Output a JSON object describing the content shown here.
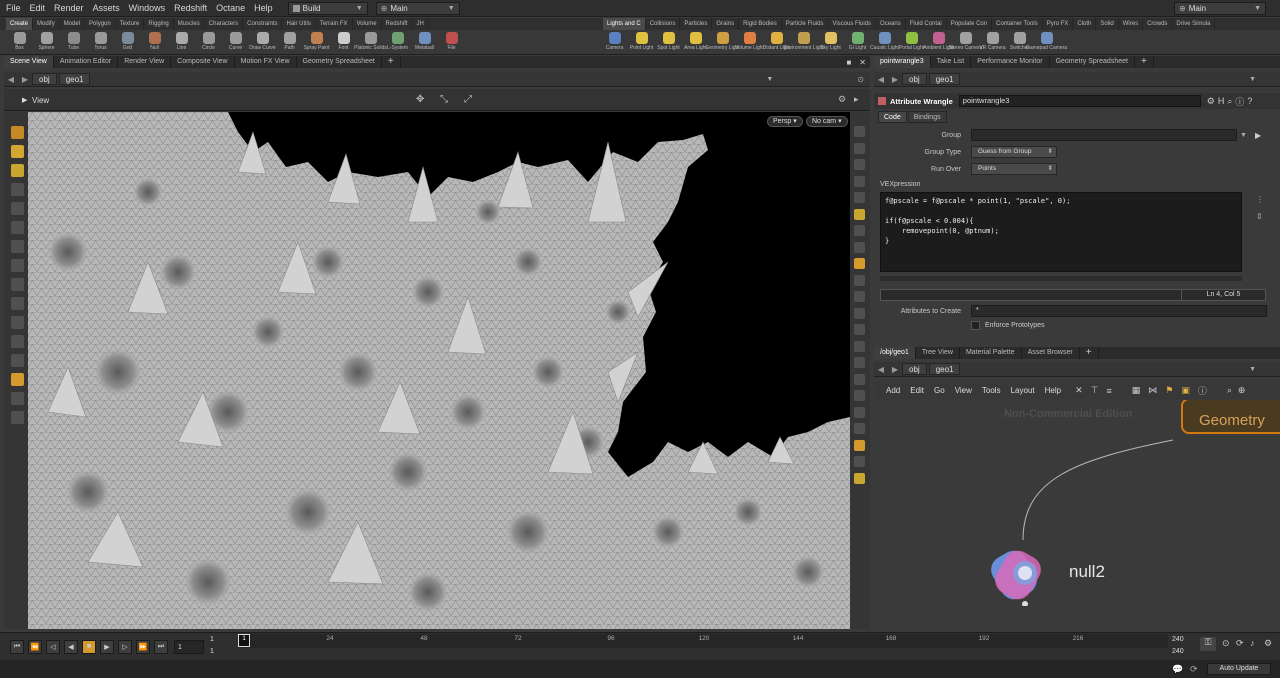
{
  "menu": [
    "File",
    "Edit",
    "Render",
    "Assets",
    "Windows",
    "Redshift",
    "Octane",
    "Help"
  ],
  "desktop": {
    "label": "Build",
    "left_set": "Main",
    "right_set": "Main"
  },
  "shelf_tabs_left": [
    "Create",
    "Modify",
    "Model",
    "Polygon",
    "Texture",
    "Rigging",
    "Muscles",
    "Characters",
    "Constraints",
    "Hair Utils",
    "Terrain FX",
    "Volume",
    "Redshift",
    "JH"
  ],
  "shelf_tabs_right": [
    "Lights and C",
    "Collisions",
    "Particles",
    "Grains",
    "Rigid Bodies",
    "Particle Fluids",
    "Viscous Fluids",
    "Oceans",
    "Fluid Contai",
    "Populate Con",
    "Container Tools",
    "Pyro FX",
    "Cloth",
    "Solid",
    "Wires",
    "Crowds",
    "Drive Simula"
  ],
  "tools_left": [
    "Box",
    "Sphere",
    "Tube",
    "Torus",
    "Grid",
    "Null",
    "Line",
    "Circle",
    "Curve",
    "Draw Curve",
    "Path",
    "Spray Paint",
    "Font",
    "Platonic Solids",
    "L-System",
    "Metaball",
    "File"
  ],
  "tools_right": [
    "Camera",
    "Point Light",
    "Spot Light",
    "Area Light",
    "Geometry Light",
    "Volume Light",
    "Distant Light",
    "Environment Light",
    "Sky Light",
    "GI Light",
    "Caustic Light",
    "Portal Light",
    "Ambient Light",
    "Stereo Camera",
    "VR Camera",
    "Switcher",
    "Gamepad Camera"
  ],
  "left_panel": {
    "tabs": [
      "Scene View",
      "Animation Editor",
      "Render View",
      "Composite View",
      "Motion FX View",
      "Geometry Spreadsheet"
    ],
    "path": [
      "obj",
      "geo1"
    ],
    "view_label": "View",
    "persp": "Persp",
    "cam": "No cam"
  },
  "param_panel": {
    "tabs": [
      "pointwrangle3",
      "Take List",
      "Performance Monitor",
      "Geometry Spreadsheet"
    ],
    "path": [
      "obj",
      "geo1"
    ],
    "node_type": "Attribute Wrangle",
    "node_name": "pointwrangle3",
    "subtabs": [
      "Code",
      "Bindings"
    ],
    "group_label": "Group",
    "group_value": "",
    "group_type_label": "Group Type",
    "group_type_value": "Guess from Group",
    "run_over_label": "Run Over",
    "run_over_value": "Points",
    "vex_label": "VEXpression",
    "code": "f@pscale = f@pscale * point(1, \"pscale\", 0);\n\nif(f@pscale < 0.004){\n    removepoint(0, @ptnum);\n}",
    "status": "Ln 4, Col 5",
    "attrs_label": "Attributes to Create",
    "attrs_value": "*",
    "enforce_label": "Enforce Prototypes"
  },
  "network_panel": {
    "tabs": [
      "/obj/geo1",
      "Tree View",
      "Material Palette",
      "Asset Browser"
    ],
    "path": [
      "obj",
      "geo1"
    ],
    "menus": [
      "Add",
      "Edit",
      "Go",
      "View",
      "Tools",
      "Layout",
      "Help"
    ],
    "watermark": "Non-Commercial Edition",
    "geometry_label": "Geometry",
    "node_name": "null2"
  },
  "timeline": {
    "start": "1",
    "current": "1",
    "range_start": "1",
    "ticks": [
      "1",
      "24",
      "48",
      "72",
      "96",
      "120",
      "144",
      "168",
      "192",
      "216"
    ],
    "end": "240",
    "end2": "240",
    "auto_update": "Auto Update"
  },
  "colors": {
    "accent": "#d59a2d",
    "viewport_bg": "#000000",
    "mesh": "#b9b9b9"
  }
}
